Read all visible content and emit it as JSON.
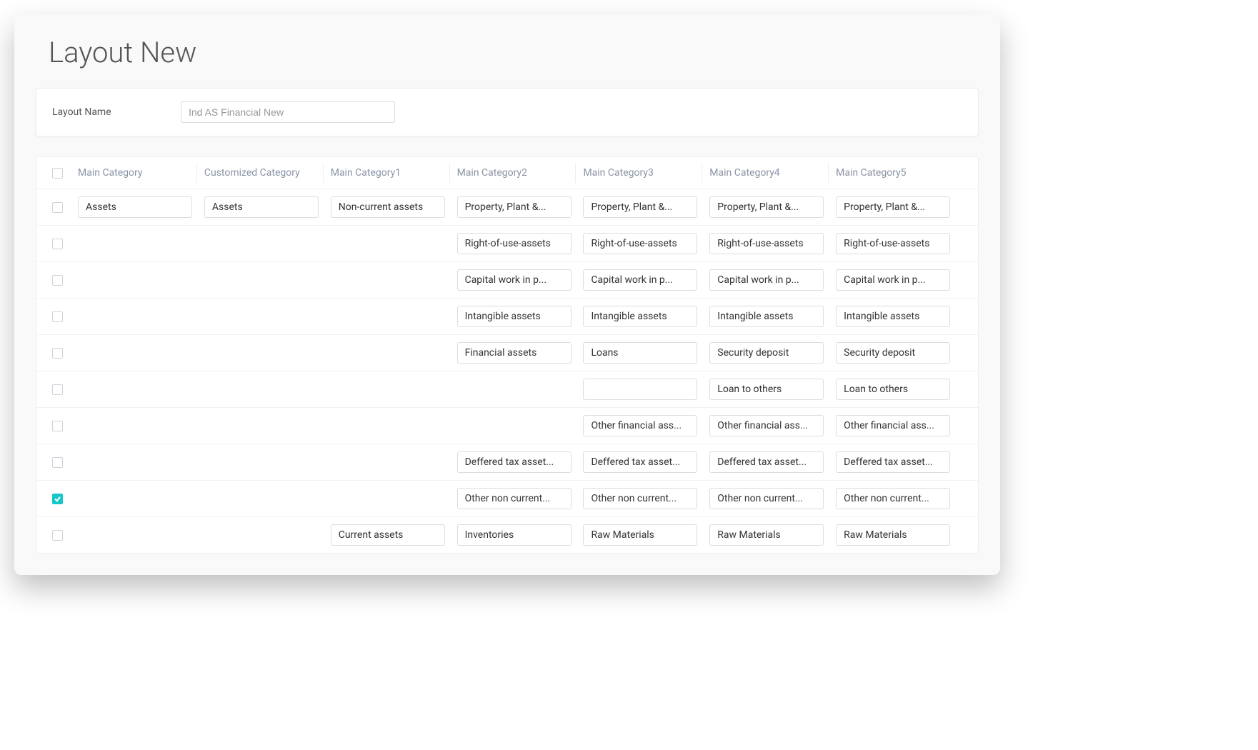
{
  "title": "Layout New",
  "form": {
    "layoutNameLabel": "Layout Name",
    "layoutNameValue": "Ind AS Financial New"
  },
  "columns": [
    "Main Category",
    "Customized Category",
    "Main Category1",
    "Main Category2",
    "Main Category3",
    "Main Category4",
    "Main Category5"
  ],
  "rows": [
    {
      "checked": false,
      "cells": [
        "Assets",
        "Assets",
        "Non-current assets",
        "Property, Plant &...",
        "Property, Plant &...",
        "Property, Plant &...",
        "Property, Plant &..."
      ]
    },
    {
      "checked": false,
      "cells": [
        null,
        null,
        null,
        "Right-of-use-assets",
        "Right-of-use-assets",
        "Right-of-use-assets",
        "Right-of-use-assets"
      ]
    },
    {
      "checked": false,
      "cells": [
        null,
        null,
        null,
        "Capital work in p...",
        "Capital work in p...",
        "Capital work in p...",
        "Capital work in p..."
      ]
    },
    {
      "checked": false,
      "cells": [
        null,
        null,
        null,
        "Intangible assets",
        "Intangible assets",
        "Intangible assets",
        "Intangible assets"
      ]
    },
    {
      "checked": false,
      "cells": [
        null,
        null,
        null,
        "Financial assets",
        "Loans",
        "Security deposit",
        "Security deposit"
      ]
    },
    {
      "checked": false,
      "cells": [
        null,
        null,
        null,
        null,
        "",
        "Loan to others",
        "Loan to others"
      ]
    },
    {
      "checked": false,
      "cells": [
        null,
        null,
        null,
        null,
        "Other financial ass...",
        "Other financial ass...",
        "Other financial ass..."
      ]
    },
    {
      "checked": false,
      "cells": [
        null,
        null,
        null,
        "Deffered tax asset...",
        "Deffered tax asset...",
        "Deffered tax asset...",
        "Deffered tax asset..."
      ]
    },
    {
      "checked": true,
      "cells": [
        null,
        null,
        null,
        "Other non current...",
        "Other non current...",
        "Other non current...",
        "Other non current..."
      ]
    },
    {
      "checked": false,
      "cells": [
        null,
        null,
        "Current assets",
        "Inventories",
        "Raw Materials",
        "Raw Materials",
        "Raw Materials"
      ]
    }
  ]
}
